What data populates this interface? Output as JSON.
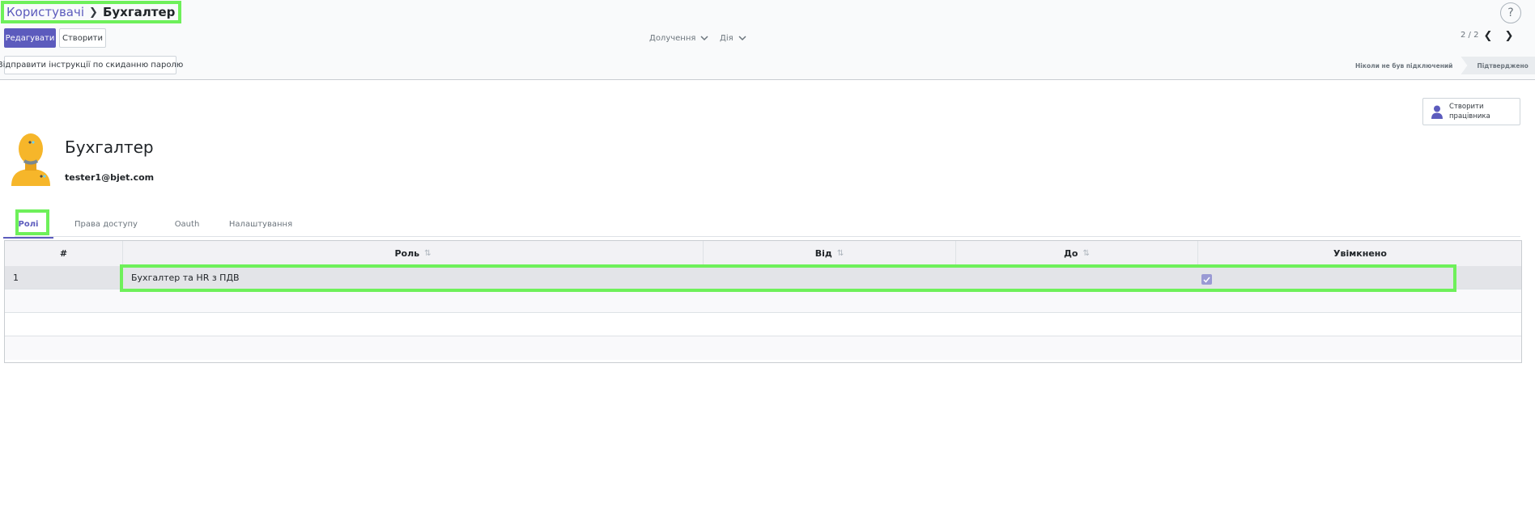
{
  "breadcrumb": {
    "parent": "Користувачі",
    "current": "Бухгалтер"
  },
  "toolbar": {
    "edit_label": "Редагувати",
    "create_label": "Створити",
    "dropdowns": [
      "Долучення",
      "Дія"
    ],
    "pager": "2 / 2",
    "help": "?"
  },
  "statusbar": {
    "reset_password_label": "Відправити інструкції по скиданню паролю",
    "steps": [
      "Ніколи не був підключений",
      "Підтверджено"
    ]
  },
  "smart_button": {
    "label": "Створити працівника"
  },
  "user": {
    "name": "Бухгалтер",
    "email": "tester1@bjet.com"
  },
  "tabs": [
    "Ролі",
    "Права доступу",
    "Oauth",
    "Налаштування"
  ],
  "roles_table": {
    "columns": [
      "#",
      "Роль",
      "Від",
      "До",
      "Увімкнено"
    ],
    "rows": [
      {
        "index": "1",
        "role": "Бухгалтер та HR з ПДВ",
        "from": "",
        "to": "",
        "enabled": true
      }
    ]
  },
  "colors": {
    "primary": "#5c5bbd",
    "highlight": "#6ef05a",
    "checkbox": "#9a9ad4"
  }
}
